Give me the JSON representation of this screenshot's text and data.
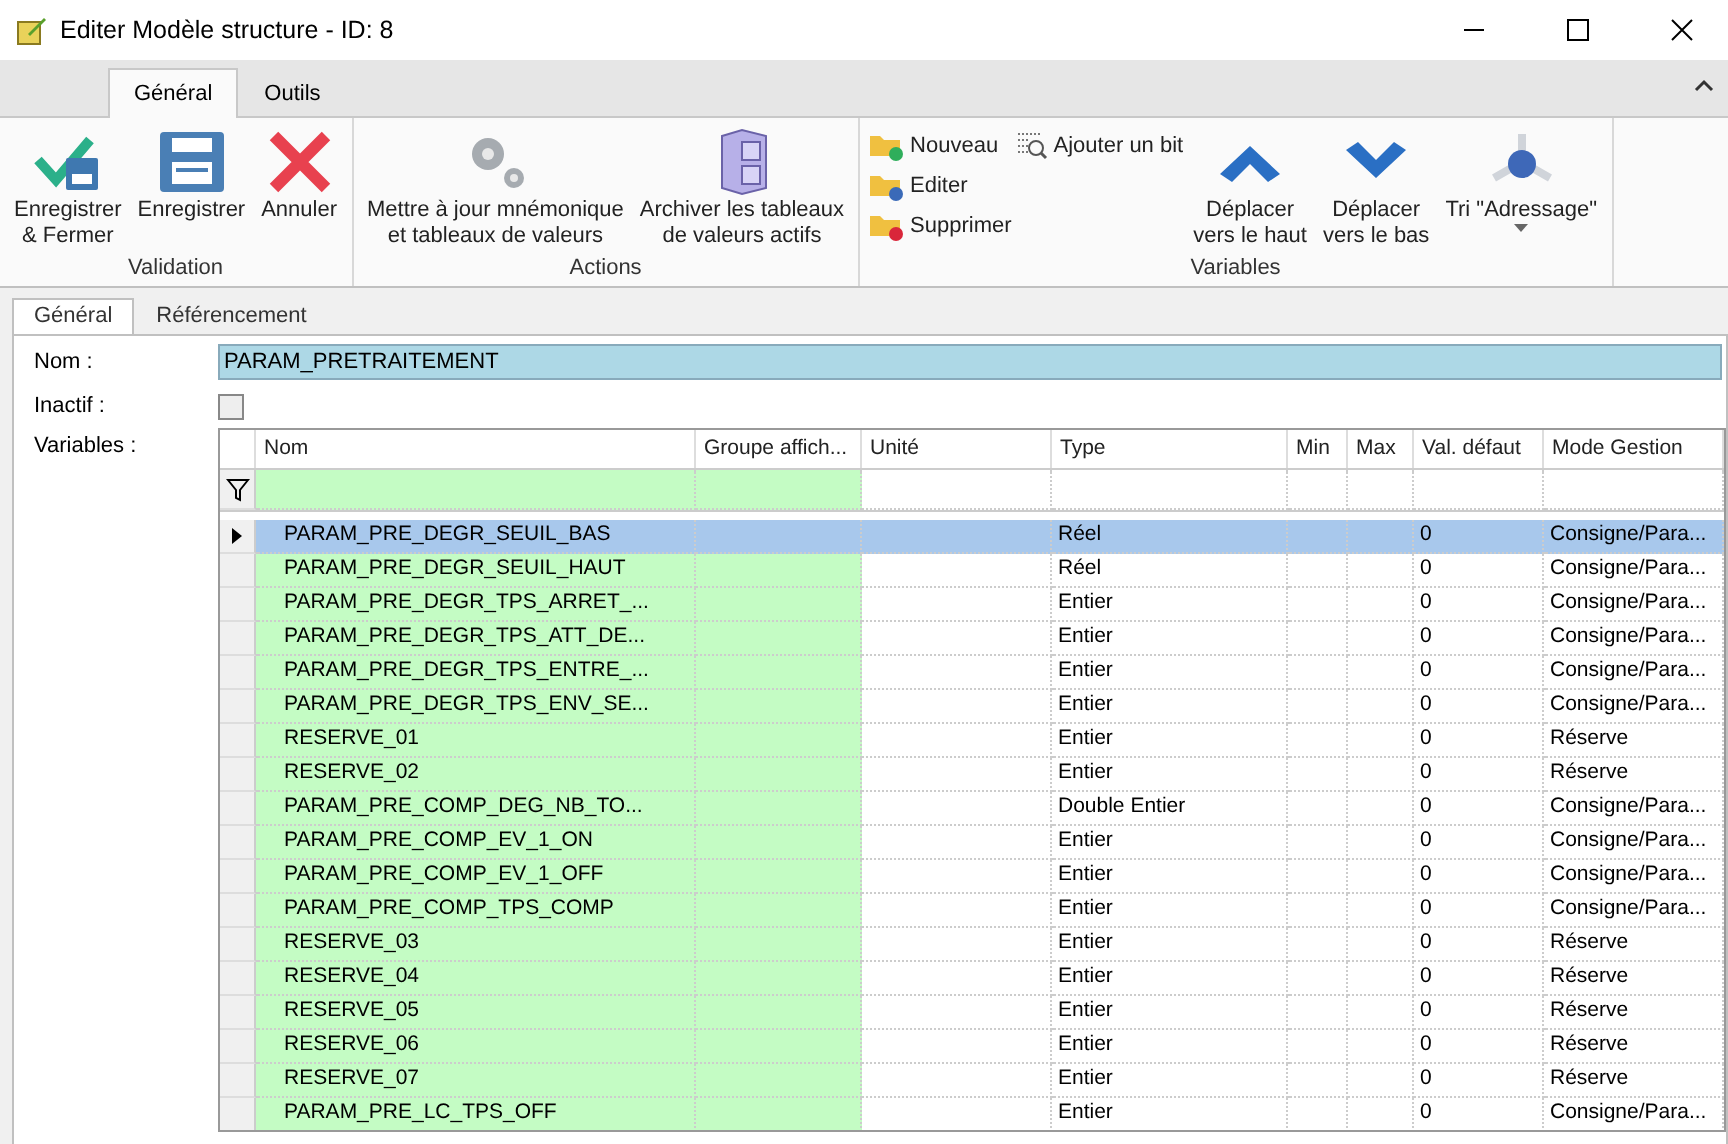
{
  "window": {
    "title": "Editer Modèle structure - ID: 8"
  },
  "ribbon_tabs": [
    {
      "label": "Général",
      "selected": true
    },
    {
      "label": "Outils",
      "selected": false
    }
  ],
  "ribbon_groups": [
    {
      "label": "Validation",
      "buttons": [
        {
          "label": "Enregistrer\n& Fermer"
        },
        {
          "label": "Enregistrer"
        },
        {
          "label": "Annuler"
        }
      ]
    },
    {
      "label": "Actions",
      "buttons": [
        {
          "label": "Mettre à jour mnémonique\net tableaux de valeurs"
        },
        {
          "label": "Archiver les tableaux\nde valeurs actifs"
        }
      ]
    },
    {
      "label": "Variables",
      "small_buttons": [
        {
          "label": "Nouveau"
        },
        {
          "label": "Editer"
        },
        {
          "label": "Supprimer"
        },
        {
          "label": "Ajouter un bit"
        }
      ],
      "buttons": [
        {
          "label": "Déplacer\nvers le haut"
        },
        {
          "label": "Déplacer\nvers le bas"
        },
        {
          "label": "Tri \"Adressage\""
        }
      ]
    }
  ],
  "page_tabs": [
    {
      "label": "Général",
      "selected": true
    },
    {
      "label": "Référencement",
      "selected": false
    }
  ],
  "form": {
    "name_label": "Nom :",
    "name_value": "PARAM_PRETRAITEMENT",
    "inactive_label": "Inactif :",
    "inactive_checked": false,
    "variables_label": "Variables :"
  },
  "table": {
    "columns": [
      "Nom",
      "Groupe affich...",
      "Unité",
      "Type",
      "Min",
      "Max",
      "Val. défaut",
      "Mode Gestion"
    ],
    "rows": [
      {
        "name": "PARAM_PRE_DEGR_SEUIL_BAS",
        "type": "Réel",
        "default": "0",
        "mode": "Consigne/Para...",
        "selected": true
      },
      {
        "name": "PARAM_PRE_DEGR_SEUIL_HAUT",
        "type": "Réel",
        "default": "0",
        "mode": "Consigne/Para...",
        "selected": false
      },
      {
        "name": "PARAM_PRE_DEGR_TPS_ARRET_...",
        "type": "Entier",
        "default": "0",
        "mode": "Consigne/Para...",
        "selected": false
      },
      {
        "name": "PARAM_PRE_DEGR_TPS_ATT_DE...",
        "type": "Entier",
        "default": "0",
        "mode": "Consigne/Para...",
        "selected": false
      },
      {
        "name": "PARAM_PRE_DEGR_TPS_ENTRE_...",
        "type": "Entier",
        "default": "0",
        "mode": "Consigne/Para...",
        "selected": false
      },
      {
        "name": "PARAM_PRE_DEGR_TPS_ENV_SE...",
        "type": "Entier",
        "default": "0",
        "mode": "Consigne/Para...",
        "selected": false
      },
      {
        "name": "RESERVE_01",
        "type": "Entier",
        "default": "0",
        "mode": "Réserve",
        "selected": false
      },
      {
        "name": "RESERVE_02",
        "type": "Entier",
        "default": "0",
        "mode": "Réserve",
        "selected": false
      },
      {
        "name": "PARAM_PRE_COMP_DEG_NB_TO...",
        "type": "Double Entier",
        "default": "0",
        "mode": "Consigne/Para...",
        "selected": false
      },
      {
        "name": "PARAM_PRE_COMP_EV_1_ON",
        "type": "Entier",
        "default": "0",
        "mode": "Consigne/Para...",
        "selected": false
      },
      {
        "name": "PARAM_PRE_COMP_EV_1_OFF",
        "type": "Entier",
        "default": "0",
        "mode": "Consigne/Para...",
        "selected": false
      },
      {
        "name": "PARAM_PRE_COMP_TPS_COMP",
        "type": "Entier",
        "default": "0",
        "mode": "Consigne/Para...",
        "selected": false
      },
      {
        "name": "RESERVE_03",
        "type": "Entier",
        "default": "0",
        "mode": "Réserve",
        "selected": false
      },
      {
        "name": "RESERVE_04",
        "type": "Entier",
        "default": "0",
        "mode": "Réserve",
        "selected": false
      },
      {
        "name": "RESERVE_05",
        "type": "Entier",
        "default": "0",
        "mode": "Réserve",
        "selected": false
      },
      {
        "name": "RESERVE_06",
        "type": "Entier",
        "default": "0",
        "mode": "Réserve",
        "selected": false
      },
      {
        "name": "RESERVE_07",
        "type": "Entier",
        "default": "0",
        "mode": "Réserve",
        "selected": false
      },
      {
        "name": "PARAM_PRE_LC_TPS_OFF",
        "type": "Entier",
        "default": "0",
        "mode": "Consigne/Para...",
        "selected": false
      }
    ]
  }
}
